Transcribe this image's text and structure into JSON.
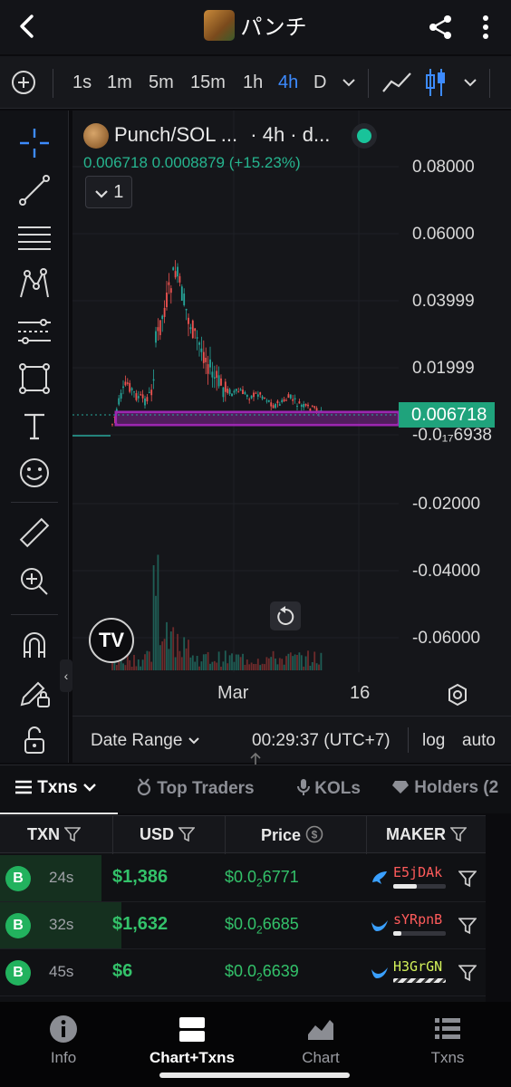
{
  "header": {
    "title": "パンチ"
  },
  "toolbar": {
    "timeframes": [
      "1s",
      "1m",
      "5m",
      "15m",
      "1h",
      "4h",
      "D"
    ],
    "active_timeframe": "4h"
  },
  "chart": {
    "symbol": "Punch/SOL ...",
    "interval": "· 4h · d...",
    "ohlc": "0.006718  0.0008879 (+15.23%)",
    "collapse_count": "1",
    "y_labels": [
      "0.08000",
      "0.06000",
      "0.03999",
      "0.01999",
      "-0.0₁₇6938",
      "-0.02000",
      "-0.04000",
      "-0.06000"
    ],
    "last_price": "0.006718",
    "x_labels": [
      "Mar",
      "16"
    ],
    "date_range": "Date Range",
    "clock": "00:29:37 (UTC+7)",
    "log": "log",
    "auto": "auto",
    "colors": {
      "up": "#26a69a",
      "down": "#ef5350",
      "highlight": "#9c27b0"
    }
  },
  "tabs": {
    "txns": "Txns",
    "top_traders": "Top Traders",
    "kols": "KOLs",
    "holders": "Holders (2"
  },
  "table": {
    "headers": {
      "txn": "TXN",
      "usd": "USD",
      "price": "Price",
      "maker": "MAKER"
    },
    "rows": [
      {
        "type": "B",
        "age": "24s",
        "usd": "$1,386",
        "price_prefix": "$0.0",
        "price_sub": "2",
        "price_tail": "6771",
        "maker": "E5jDAk",
        "maker_color": "#ff5b5b",
        "bar": 0.45
      },
      {
        "type": "B",
        "age": "32s",
        "usd": "$1,632",
        "price_prefix": "$0.0",
        "price_sub": "2",
        "price_tail": "6685",
        "maker": "sYRpnB",
        "maker_color": "#ff5b5b",
        "bar": 0.15
      },
      {
        "type": "B",
        "age": "45s",
        "usd": "$6",
        "price_prefix": "$0.0",
        "price_sub": "2",
        "price_tail": "6639",
        "maker": "H3GrGN",
        "maker_color": "#d4f25a",
        "bar": 1.0
      }
    ]
  },
  "nav": {
    "info": "Info",
    "chart_txns": "Chart+Txns",
    "chart": "Chart",
    "txns": "Txns"
  }
}
